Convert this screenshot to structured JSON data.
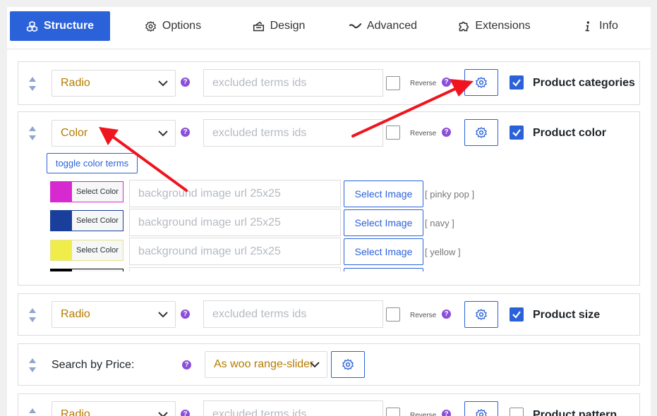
{
  "tabs": [
    {
      "label": "Structure",
      "icon": "cubes-icon",
      "active": true
    },
    {
      "label": "Options",
      "icon": "gear-icon"
    },
    {
      "label": "Design",
      "icon": "design-icon"
    },
    {
      "label": "Advanced",
      "icon": "wave-icon"
    },
    {
      "label": "Extensions",
      "icon": "puzzle-icon"
    },
    {
      "label": "Info",
      "icon": "info-icon"
    }
  ],
  "common": {
    "help_mark": "?",
    "reverse_label": "Reverse",
    "excluded_placeholder": "excluded terms ids"
  },
  "filters": {
    "categories": {
      "type": "Radio",
      "label": "Product categories",
      "enabled": true
    },
    "color": {
      "type": "Color",
      "label": "Product color",
      "enabled": true,
      "toggle_label": "toggle color terms",
      "select_color_label": "Select Color",
      "bg_placeholder": "background image url 25x25",
      "select_image_label": "Select Image",
      "terms": [
        {
          "name": "[ pinky pop ]",
          "color": "#d62ad0"
        },
        {
          "name": "[ navy ]",
          "color": "#1a3f9a"
        },
        {
          "name": "[ yellow ]",
          "color": "#f0ed4a"
        },
        {
          "name": "",
          "color": "#000000"
        }
      ]
    },
    "size": {
      "type": "Radio",
      "label": "Product size",
      "enabled": true
    },
    "price": {
      "label": "Search by Price:",
      "type": "As woo range-slider"
    },
    "pattern": {
      "type": "Radio",
      "label": "Product pattern",
      "enabled": false
    }
  },
  "colors": {
    "accent": "#2b62d9",
    "select_text": "#b57b00",
    "help": "#8a4fd8",
    "annotation_arrow": "#f0141e"
  }
}
